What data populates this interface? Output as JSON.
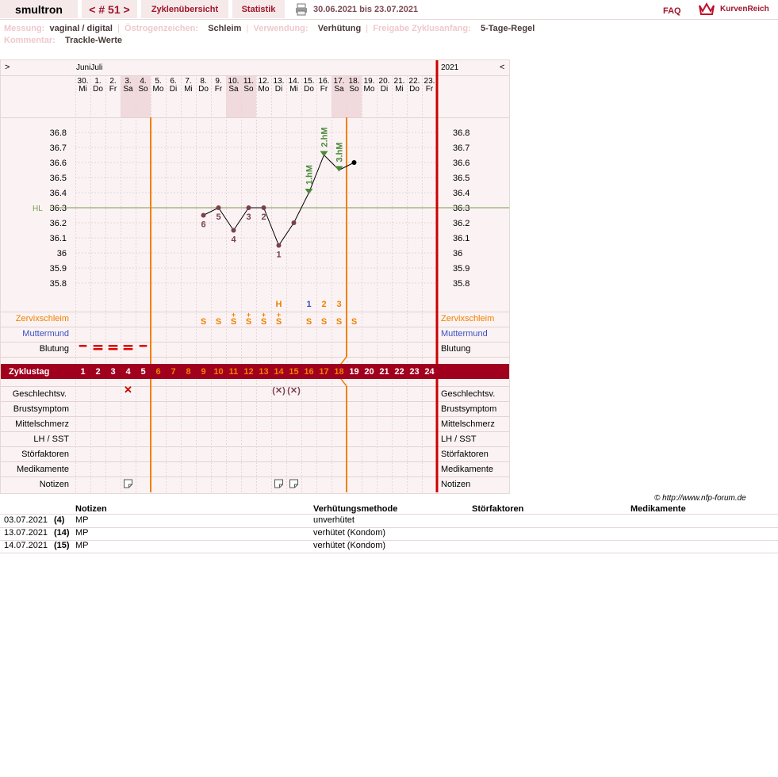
{
  "header": {
    "user": "smultron",
    "cycle_nav": "< # 51 >",
    "tab_overview": "Zyklenübersicht",
    "tab_stats": "Statistik",
    "date_range": "30.06.2021 bis 23.07.2021",
    "faq": "FAQ",
    "brand": "KurvenReich"
  },
  "info": {
    "messung_label": "Messung:",
    "messung_value": "vaginal / digital",
    "oestrogen_label": "Östrogenzeichen:",
    "oestrogen_value": "Schleim",
    "verwendung_label": "Verwendung:",
    "verwendung_value": "Verhütung",
    "freigabe_label": "Freigabe Zyklusanfang:",
    "freigabe_value": "5-Tage-Regel",
    "kommentar_label": "Kommentar:",
    "kommentar_value": "Trackle-Werte"
  },
  "chart_header": {
    "left_arrow": ">",
    "right_arrow": "<",
    "months": "JuniJuli",
    "year": "2021"
  },
  "days": [
    {
      "d": "30.",
      "w": "Mi"
    },
    {
      "d": "1.",
      "w": "Do"
    },
    {
      "d": "2.",
      "w": "Fr"
    },
    {
      "d": "3.",
      "w": "Sa"
    },
    {
      "d": "4.",
      "w": "So"
    },
    {
      "d": "5.",
      "w": "Mo"
    },
    {
      "d": "6.",
      "w": "Di"
    },
    {
      "d": "7.",
      "w": "Mi"
    },
    {
      "d": "8.",
      "w": "Do"
    },
    {
      "d": "9.",
      "w": "Fr"
    },
    {
      "d": "10.",
      "w": "Sa"
    },
    {
      "d": "11.",
      "w": "So"
    },
    {
      "d": "12.",
      "w": "Mo"
    },
    {
      "d": "13.",
      "w": "Di"
    },
    {
      "d": "14.",
      "w": "Mi"
    },
    {
      "d": "15.",
      "w": "Do"
    },
    {
      "d": "16.",
      "w": "Fr"
    },
    {
      "d": "17.",
      "w": "Sa"
    },
    {
      "d": "18.",
      "w": "So"
    },
    {
      "d": "19.",
      "w": "Mo"
    },
    {
      "d": "20.",
      "w": "Di"
    },
    {
      "d": "21.",
      "w": "Mi"
    },
    {
      "d": "22.",
      "w": "Do"
    },
    {
      "d": "23.",
      "w": "Fr"
    }
  ],
  "temp_scale": [
    "36.8",
    "36.7",
    "36.6",
    "36.5",
    "36.4",
    "36.3",
    "36.2",
    "36.1",
    "36",
    "35.9",
    "35.8"
  ],
  "hl_label": "HL",
  "chart_data": {
    "type": "line",
    "x": [
      9,
      10,
      11,
      12,
      13,
      14,
      15,
      16,
      17,
      18,
      19
    ],
    "values": [
      36.25,
      36.3,
      36.15,
      36.3,
      36.3,
      36.05,
      36.2,
      36.4,
      36.65,
      36.55,
      36.6
    ],
    "coverline": 36.3,
    "ylim": [
      35.7,
      36.9
    ],
    "point_labels": {
      "9": "6",
      "10": "5",
      "11": "4",
      "12": "3",
      "13": "2",
      "14": "1"
    },
    "high_labels": {
      "16": "1.hM",
      "17": "2.hM",
      "18": "3.hM"
    }
  },
  "peak_marks": [
    {
      "day": 14,
      "text": "H",
      "color": "#f08000"
    },
    {
      "day": 16,
      "text": "1",
      "color": "#3b4fc0"
    },
    {
      "day": 17,
      "text": "2",
      "color": "#f08000"
    },
    {
      "day": 18,
      "text": "3",
      "color": "#f08000"
    }
  ],
  "mucus": [
    {
      "day": 9,
      "t": "S"
    },
    {
      "day": 10,
      "t": "S"
    },
    {
      "day": 11,
      "t": "S+"
    },
    {
      "day": 12,
      "t": "S+"
    },
    {
      "day": 13,
      "t": "S+"
    },
    {
      "day": 14,
      "t": "S+"
    },
    {
      "day": 16,
      "t": "S"
    },
    {
      "day": 17,
      "t": "S"
    },
    {
      "day": 18,
      "t": "S"
    },
    {
      "day": 19,
      "t": "S"
    }
  ],
  "rows_left": {
    "zervix": "Zervixschleim",
    "muttermund": "Muttermund",
    "blutung": "Blutung",
    "zyklustag": "Zyklustag",
    "gv": "Geschlechtsv.",
    "brust": "Brustsymptom",
    "mittel": "Mittelschmerz",
    "lh": "LH / SST",
    "stoer": "Störfaktoren",
    "medi": "Medikamente",
    "notizen": "Notizen"
  },
  "bleeding_days": [
    1,
    2,
    3,
    4,
    5
  ],
  "cycle_days": [
    "1",
    "2",
    "3",
    "4",
    "5",
    "6",
    "7",
    "8",
    "9",
    "10",
    "11",
    "12",
    "13",
    "14",
    "15",
    "16",
    "17",
    "18",
    "19",
    "20",
    "21",
    "22",
    "23",
    "24"
  ],
  "gv_marks": [
    {
      "day": 4,
      "t": "✕"
    },
    {
      "day": 14,
      "t": "(✕)"
    },
    {
      "day": 15,
      "t": "(✕)"
    }
  ],
  "note_days": [
    4,
    14,
    15
  ],
  "copyright": "© http://www.nfp-forum.de",
  "notes_table": {
    "headers": [
      "Notizen",
      "Verhütungsmethode",
      "Störfaktoren",
      "Medikamente"
    ],
    "rows": [
      {
        "date": "03.07.2021",
        "day": "(4)",
        "note": "MP",
        "method": "unverhütet"
      },
      {
        "date": "13.07.2021",
        "day": "(14)",
        "note": "MP",
        "method": "verhütet (Kondom)"
      },
      {
        "date": "14.07.2021",
        "day": "(15)",
        "note": "MP",
        "method": "verhütet (Kondom)"
      }
    ]
  },
  "colors": {
    "accent": "#a0001e",
    "orange": "#f08000",
    "blue": "#3b4fc0",
    "green": "#4a8a3a",
    "dot": "#7a4050"
  }
}
